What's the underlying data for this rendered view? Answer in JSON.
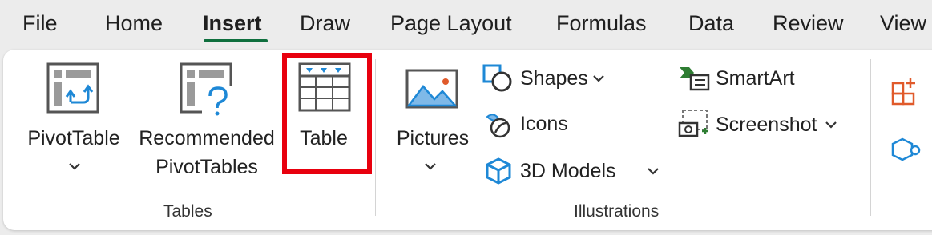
{
  "tabs": [
    {
      "label": "File",
      "active": false
    },
    {
      "label": "Home",
      "active": false
    },
    {
      "label": "Insert",
      "active": true
    },
    {
      "label": "Draw",
      "active": false
    },
    {
      "label": "Page Layout",
      "active": false
    },
    {
      "label": "Formulas",
      "active": false
    },
    {
      "label": "Data",
      "active": false
    },
    {
      "label": "Review",
      "active": false
    },
    {
      "label": "View",
      "active": false
    }
  ],
  "groups": {
    "tables": {
      "label": "Tables",
      "pivottable": "PivotTable",
      "recommended_line1": "Recommended",
      "recommended_line2": "PivotTables",
      "table": "Table"
    },
    "illustrations": {
      "label": "Illustrations",
      "pictures": "Pictures",
      "shapes": "Shapes",
      "icons": "Icons",
      "models3d": "3D Models",
      "smartart": "SmartArt",
      "screenshot": "Screenshot"
    }
  },
  "colors": {
    "accent": "#0f6f3e",
    "highlight": "#e8000e",
    "icon_blue": "#1e88d6",
    "icon_green": "#2e7d32",
    "icon_orange": "#e05a2b"
  }
}
